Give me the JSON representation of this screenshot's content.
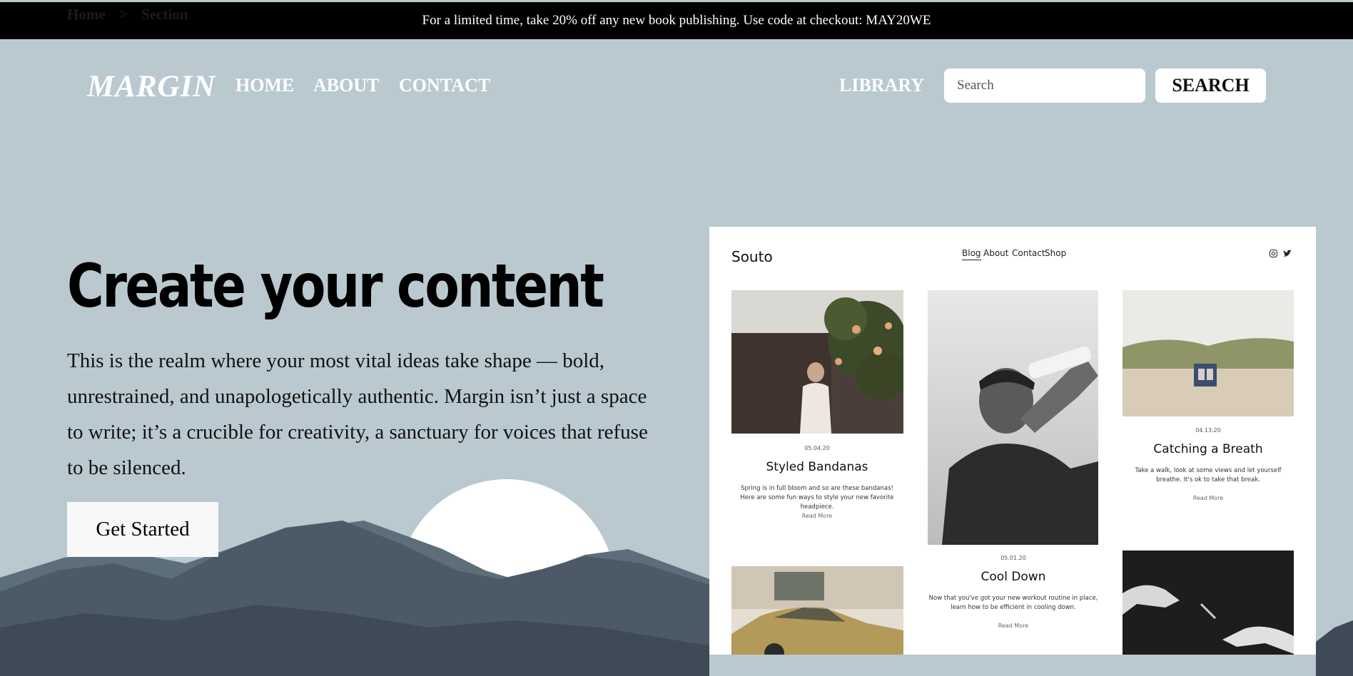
{
  "breadcrumb": {
    "home": "Home",
    "separator": ">",
    "section": "Section"
  },
  "promo": {
    "text": "For a limited time, take 20% off any new book publishing. Use code at checkout: MAY20WE"
  },
  "nav": {
    "logo": "MARGIN",
    "links": [
      {
        "label": "HOME"
      },
      {
        "label": "ABOUT"
      },
      {
        "label": "CONTACT"
      }
    ],
    "library": "LIBRARY",
    "search_placeholder": "Search",
    "search_button": "SEARCH"
  },
  "hero": {
    "title": "Create your content",
    "text": "This is the realm where your most vital ideas take shape — bold, unrestrained, and unapologetically authentic. Margin isn’t just a space to write; it’s a crucible for creativity, a sanctuary for voices that refuse to be silenced.",
    "cta": "Get Started"
  },
  "preview": {
    "brand": "Souto",
    "nav": [
      "Blog",
      "About",
      "Contact",
      "Shop"
    ],
    "social_icons": [
      "instagram-icon",
      "twitter-icon"
    ],
    "posts": [
      {
        "date": "05.04.20",
        "title": "Styled Bandanas",
        "excerpt_line1": "Spring is in full bloom and so are these bandanas!",
        "excerpt_line2": "Here are some fun ways to style your new favorite headpiece.",
        "more": "Read More"
      },
      {
        "date": "05.01.20",
        "title": "Cool Down",
        "excerpt_line1": "Now that you've got your new workout routine in place,",
        "excerpt_line2": "learn how to be efficient in cooling down.",
        "more": "Read More"
      },
      {
        "date": "04.13.20",
        "title": "Catching a Breath",
        "excerpt_line1": "Take a walk, look at some views and let yourself",
        "excerpt_line2": "breathe. It's ok to take that break.",
        "more": "Read More"
      }
    ]
  },
  "colors": {
    "background": "#b9c9cf",
    "promo_bar": "#000000",
    "mountain_far": "#536470",
    "mountain_near": "#465560",
    "sun": "#ffffff"
  }
}
